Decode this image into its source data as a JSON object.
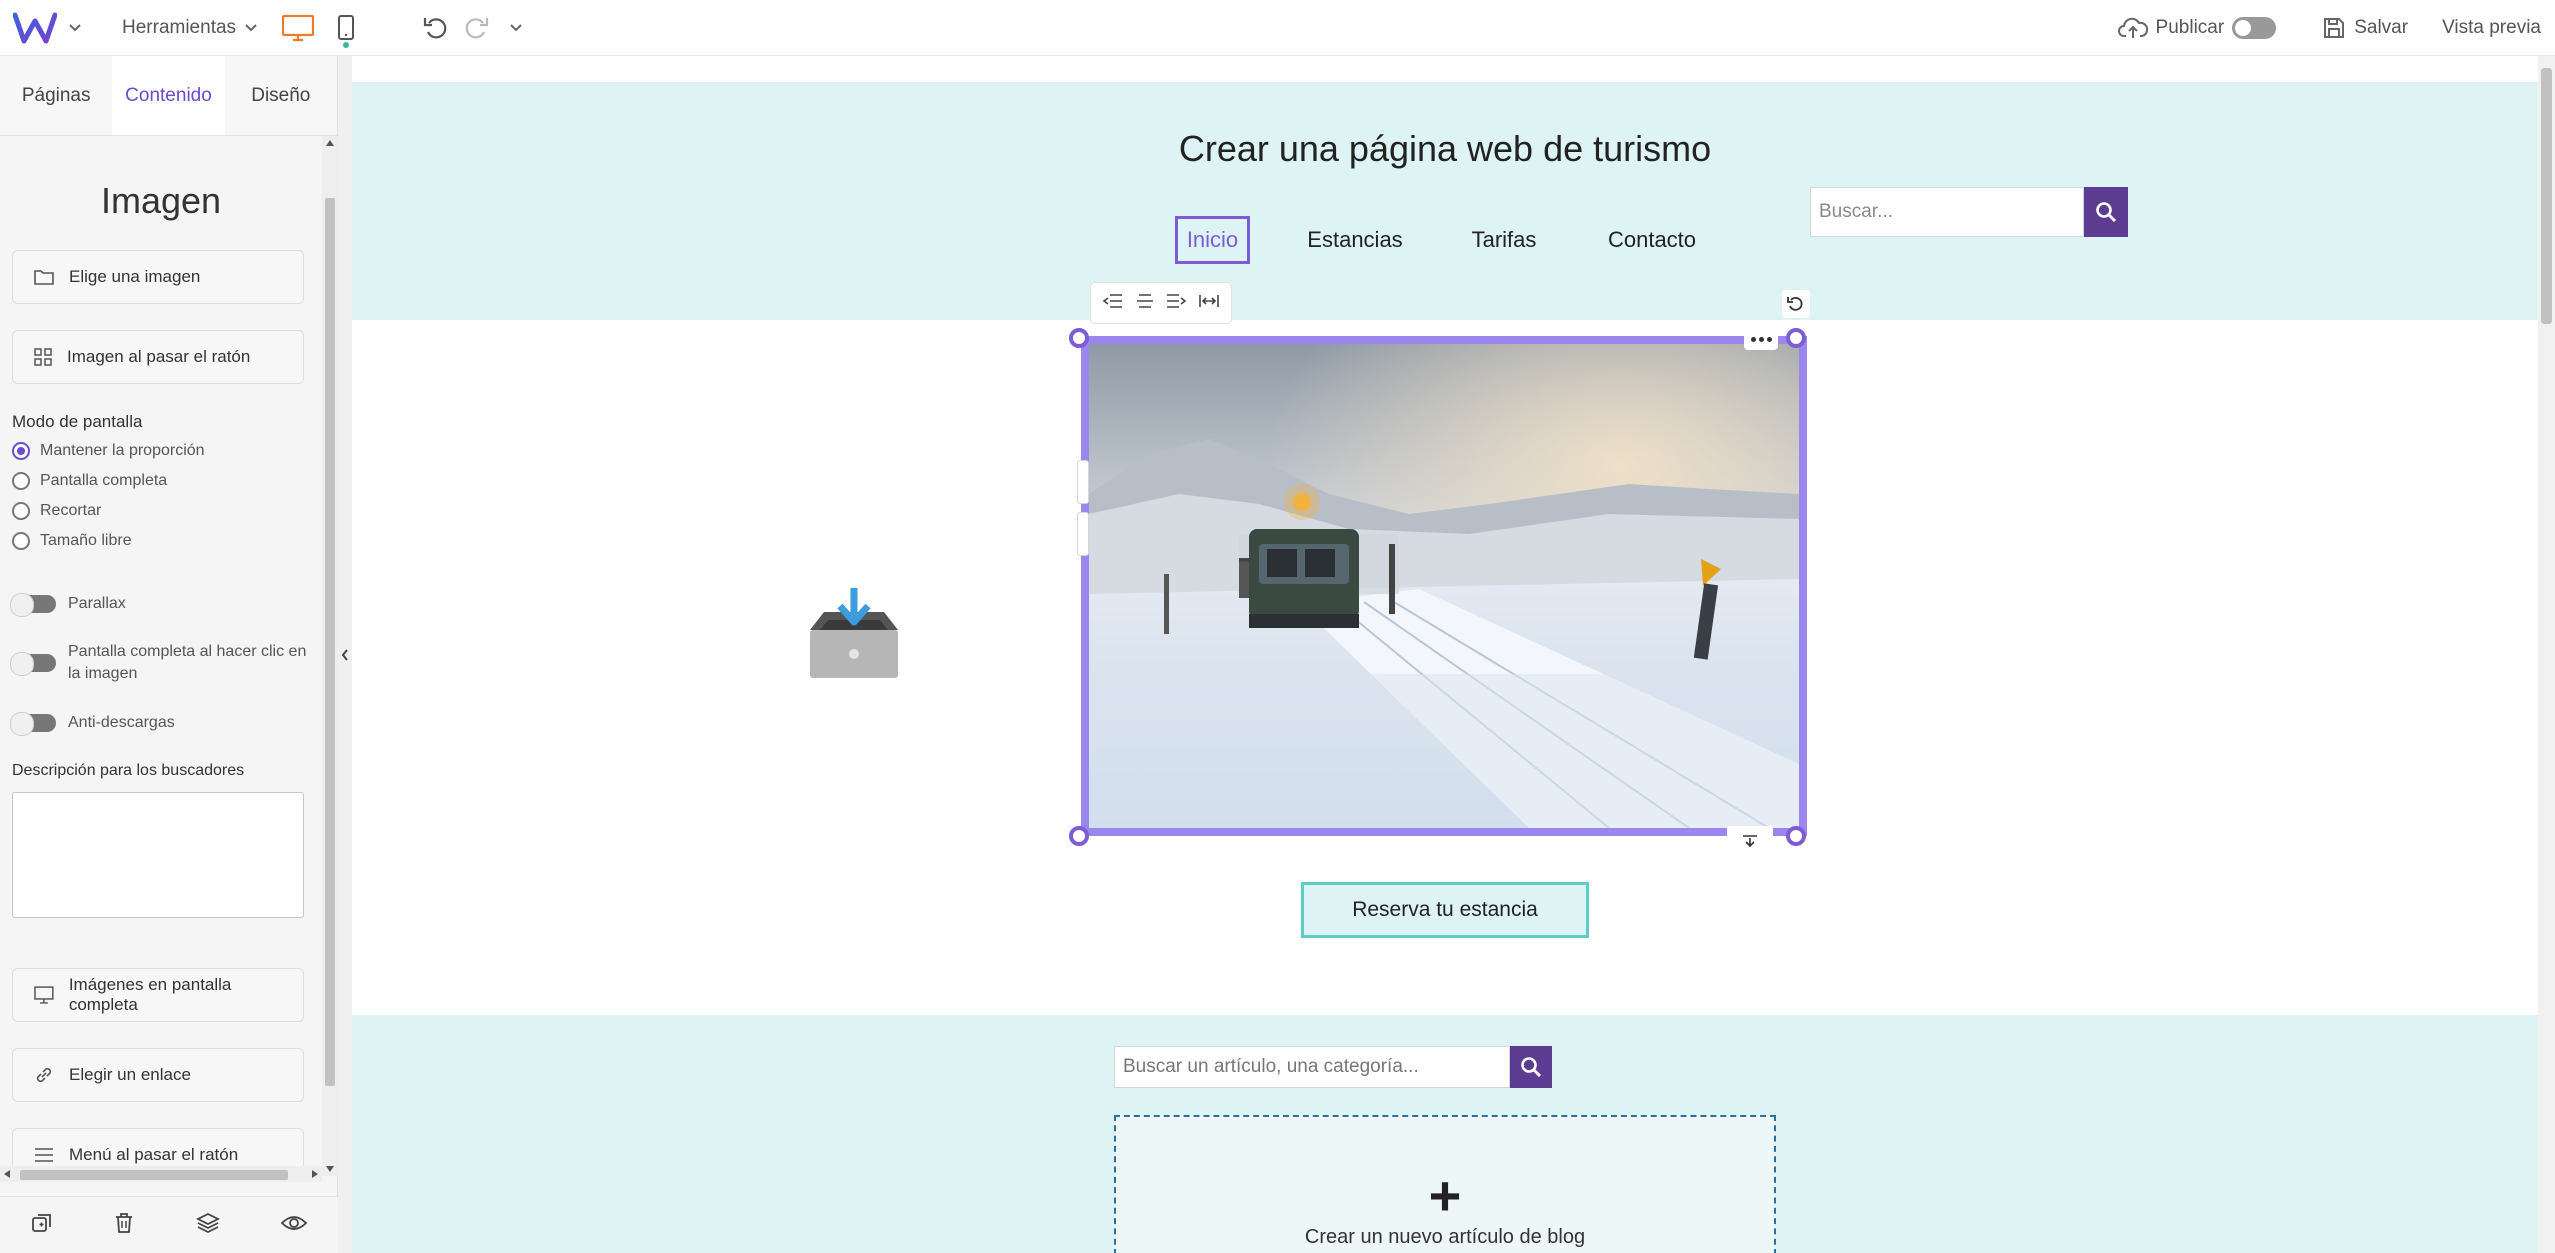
{
  "topbar": {
    "tools_label": "Herramientas",
    "publish_label": "Publicar",
    "save_label": "Salvar",
    "preview_label": "Vista previa"
  },
  "sidebar": {
    "tabs": [
      {
        "label": "Páginas"
      },
      {
        "label": "Contenido"
      },
      {
        "label": "Diseño"
      }
    ],
    "active_tab": "Contenido",
    "title": "Imagen",
    "choose_image": "Elige una imagen",
    "hover_image": "Imagen al pasar el ratón",
    "display_mode_label": "Modo de pantalla",
    "display_modes": [
      {
        "label": "Mantener la proporción",
        "selected": true
      },
      {
        "label": "Pantalla completa",
        "selected": false
      },
      {
        "label": "Recortar",
        "selected": false
      },
      {
        "label": "Tamaño libre",
        "selected": false
      }
    ],
    "toggles": [
      {
        "label": "Parallax",
        "on": false
      },
      {
        "label": "Pantalla completa al hacer clic en la imagen",
        "on": false
      },
      {
        "label": "Anti-descargas",
        "on": false
      }
    ],
    "seo_label": "Descripción para los buscadores",
    "seo_value": "",
    "fullscreen_images": "Imágenes en pantalla completa",
    "choose_link": "Elegir un enlace",
    "hover_menu": "Menú al pasar el ratón"
  },
  "site": {
    "title": "Crear una página web de turismo",
    "nav": [
      {
        "label": "Inicio",
        "active": true
      },
      {
        "label": "Estancias",
        "active": false
      },
      {
        "label": "Tarifas",
        "active": false
      },
      {
        "label": "Contacto",
        "active": false
      }
    ],
    "search_placeholder": "Buscar...",
    "cta_label": "Reserva tu estancia",
    "blog_search_placeholder": "Buscar un artículo, una categoría...",
    "new_article_label": "Crear un nuevo artículo de blog"
  },
  "colors": {
    "accent": "#6c4bd1",
    "selection": "#9b86ee",
    "header_bg": "#ddf3f4",
    "search_button": "#5b3c91",
    "cta_border": "#5ccdc9"
  },
  "icons": {
    "logo": "w-logo-icon",
    "desktop": "desktop-icon",
    "mobile": "mobile-icon",
    "undo": "undo-icon",
    "redo": "redo-icon",
    "publish": "cloud-upload-icon",
    "save": "floppy-icon",
    "search": "search-icon"
  }
}
